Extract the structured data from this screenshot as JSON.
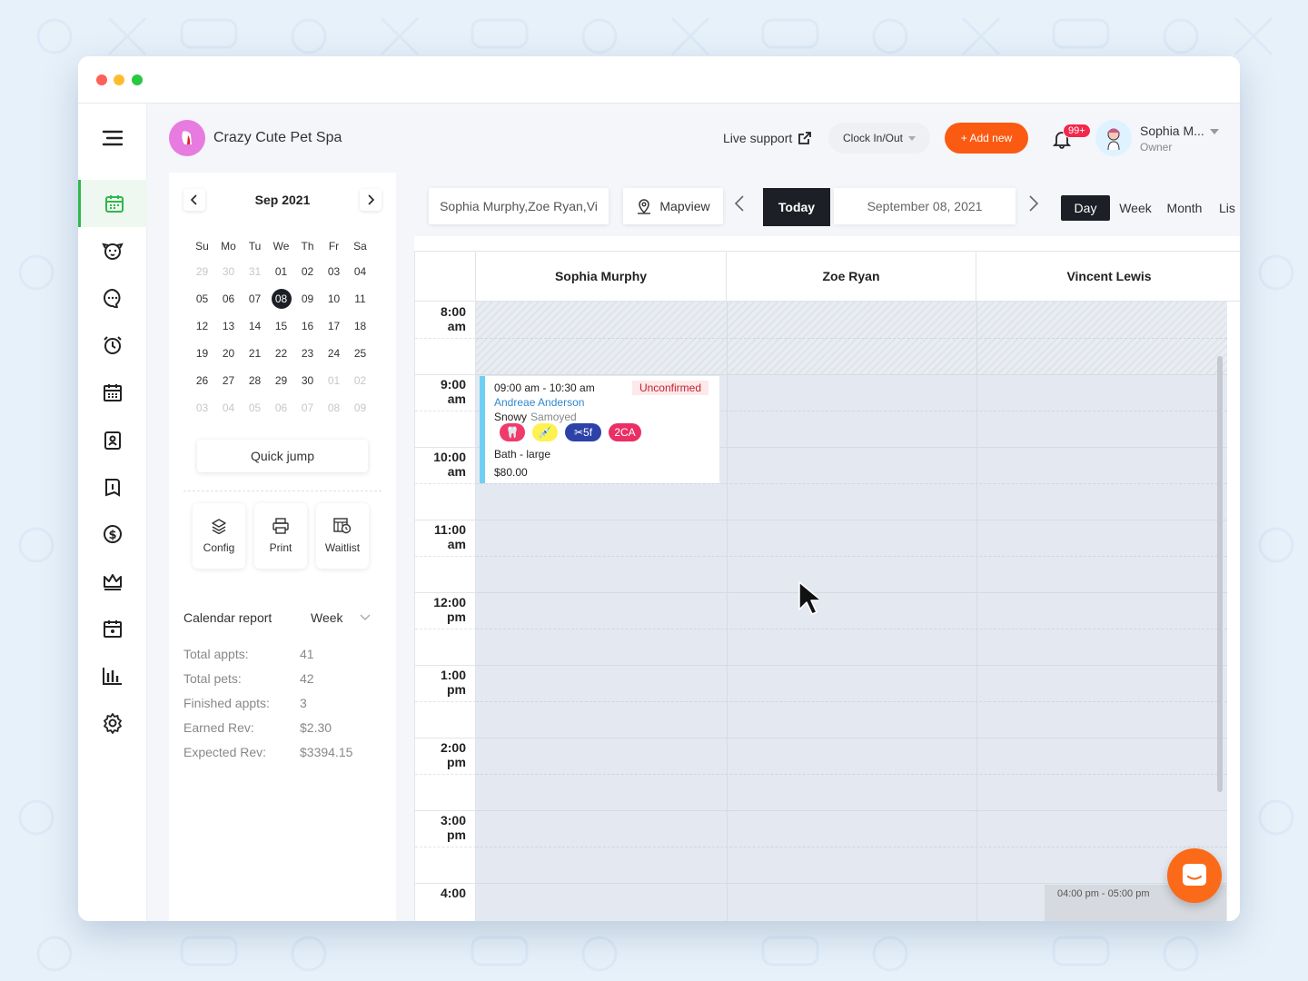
{
  "business": {
    "name": "Crazy Cute Pet Spa"
  },
  "header": {
    "live_support": "Live support",
    "clock": "Clock In/Out",
    "add_new": "+ Add new",
    "notif_count": "99+",
    "user_name": "Sophia M...",
    "user_role": "Owner"
  },
  "sidebar": {
    "icons": [
      "menu-icon",
      "calendar-icon",
      "dog-icon",
      "chat-icon",
      "alarm-icon",
      "schedule-icon",
      "clipboard-icon",
      "book-icon",
      "dollar-icon",
      "crown-icon",
      "calendar-alt-icon",
      "bar-chart-icon",
      "gear-icon"
    ]
  },
  "mini_calendar": {
    "month": "Sep 2021",
    "weekdays": [
      "Su",
      "Mo",
      "Tu",
      "We",
      "Th",
      "Fr",
      "Sa"
    ],
    "weeks": [
      [
        "29",
        "30",
        "31",
        "01",
        "02",
        "03",
        "04"
      ],
      [
        "05",
        "06",
        "07",
        "08",
        "09",
        "10",
        "11"
      ],
      [
        "12",
        "13",
        "14",
        "15",
        "16",
        "17",
        "18"
      ],
      [
        "19",
        "20",
        "21",
        "22",
        "23",
        "24",
        "25"
      ],
      [
        "26",
        "27",
        "28",
        "29",
        "30",
        "01",
        "02"
      ],
      [
        "03",
        "04",
        "05",
        "06",
        "07",
        "08",
        "09"
      ]
    ],
    "selected": "08",
    "quick_jump": "Quick jump"
  },
  "tools": {
    "config": "Config",
    "print": "Print",
    "waitlist": "Waitlist"
  },
  "report": {
    "title": "Calendar report",
    "range": "Week",
    "rows": [
      {
        "label": "Total appts:",
        "value": "41"
      },
      {
        "label": "Total pets:",
        "value": "42"
      },
      {
        "label": "Finished appts:",
        "value": "3"
      },
      {
        "label": "Earned Rev:",
        "value": "$2.30"
      },
      {
        "label": "Expected Rev:",
        "value": "$3394.15"
      }
    ]
  },
  "toolbar": {
    "staff_filter": "Sophia Murphy,Zoe Ryan,Vi",
    "mapview": "Mapview",
    "today": "Today",
    "date": "September 08, 2021",
    "views": [
      "Day",
      "Week",
      "Month",
      "Lis"
    ],
    "active_view": "Day"
  },
  "columns": [
    "Sophia Murphy",
    "Zoe Ryan",
    "Vincent Lewis"
  ],
  "times": [
    [
      "8:00",
      "am"
    ],
    [
      "9:00",
      "am"
    ],
    [
      "10:00",
      "am"
    ],
    [
      "11:00",
      "am"
    ],
    [
      "12:00",
      "pm"
    ],
    [
      "1:00",
      "pm"
    ],
    [
      "2:00",
      "pm"
    ],
    [
      "3:00",
      "pm"
    ],
    [
      "4:00",
      ""
    ]
  ],
  "appointment": {
    "time": "09:00 am - 10:30 am",
    "status": "Unconfirmed",
    "client": "Andreae Anderson",
    "pet": "Snowy",
    "breed": "Samoyed",
    "tags": [
      "🦷",
      "💉",
      "✂5f",
      "2CA"
    ],
    "service": "Bath - large",
    "price": "$80.00"
  },
  "ghost_appt": "04:00 pm - 05:00 pm",
  "colors": {
    "accent": "#fb5a13",
    "active_green": "#2eb84b",
    "dark": "#1c1f26"
  }
}
